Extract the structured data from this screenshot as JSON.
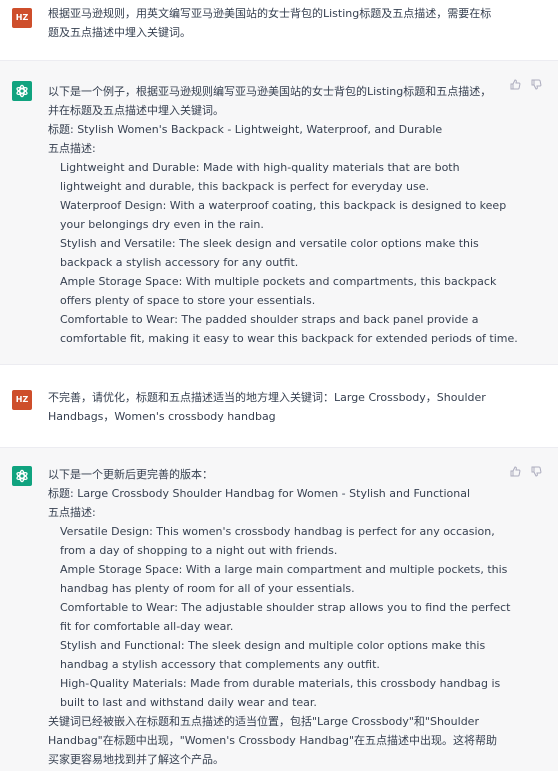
{
  "conversation": [
    {
      "role": "user",
      "avatar": "HZ",
      "lines": [
        "根据亚马逊规则，用英文编写亚马逊美国站的女士背包的Listing标题及五点描述，需要在标",
        "题及五点描述中埋入关键词。"
      ]
    },
    {
      "role": "assistant",
      "lines": [
        "以下是一个例子，根据亚马逊规则编写亚马逊美国站的女士背包的Listing标题和五点描述，",
        "并在标题及五点描述中埋入关键词。",
        "标题: Stylish Women's Backpack - Lightweight, Waterproof, and Durable",
        "五点描述:"
      ],
      "bullets": [
        "Lightweight and Durable: Made with high-quality materials that are both",
        "lightweight and durable, this backpack is perfect for everyday use.",
        "Waterproof Design: With a waterproof coating, this backpack is designed to keep",
        "your belongings dry even in the rain.",
        "Stylish and Versatile: The sleek design and versatile color options make this",
        "backpack a stylish accessory for any outfit.",
        "Ample Storage Space: With multiple pockets and compartments, this backpack",
        "offers plenty of space to store your essentials.",
        "Comfortable to Wear: The padded shoulder straps and back panel provide a",
        "comfortable fit, making it easy to wear this backpack for extended periods of time."
      ]
    },
    {
      "role": "user",
      "avatar": "HZ",
      "lines": [
        "不完善，请优化，标题和五点描述适当的地方埋入关键词：Large Crossbody，Shoulder",
        "Handbags，Women's crossbody handbag"
      ]
    },
    {
      "role": "assistant",
      "lines": [
        "以下是一个更新后更完善的版本：",
        "标题: Large Crossbody Shoulder Handbag for Women - Stylish and Functional",
        "五点描述:"
      ],
      "bullets": [
        "Versatile Design: This women's crossbody handbag is perfect for any occasion,",
        "from a day of shopping to a night out with friends.",
        "Ample Storage Space: With a large main compartment and multiple pockets, this",
        "handbag has plenty of room for all of your essentials.",
        "Comfortable to Wear: The adjustable shoulder strap allows you to find the perfect",
        "fit for comfortable all-day wear.",
        "Stylish and Functional: The sleek design and multiple color options make this",
        "handbag a stylish accessory that complements any outfit.",
        "High-Quality Materials: Made from durable materials, this crossbody handbag is",
        "built to last and withstand daily wear and tear."
      ],
      "after": [
        "关键词已经被嵌入在标题和五点描述的适当位置，包括\"Large Crossbody\"和\"Shoulder",
        "Handbag\"在标题中出现，\"Women's Crossbody Handbag\"在五点描述中出现。这将帮助",
        "买家更容易地找到并了解这个产品。"
      ]
    }
  ],
  "icons": {
    "assistant_avatar": "openai-logo-icon",
    "upvote": "thumbs-up-icon",
    "downvote": "thumbs-down-icon"
  }
}
